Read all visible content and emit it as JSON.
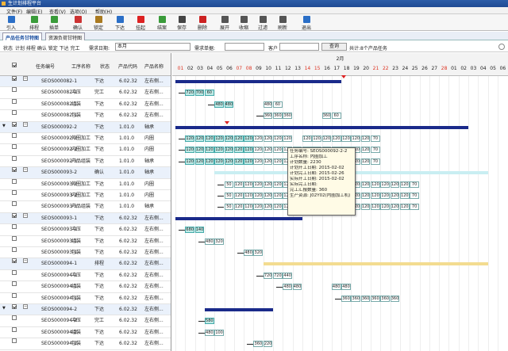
{
  "window": {
    "title": "生计划排程平台"
  },
  "menu": [
    "文件(F)",
    "编辑(E)",
    "查看(V)",
    "选项(O)",
    "帮助(H)"
  ],
  "toolbar": [
    {
      "label": "引入",
      "icon": "import-icon",
      "color": "#2b6fc7"
    },
    {
      "label": "排程",
      "icon": "schedule-icon",
      "color": "#3a9b3a"
    },
    {
      "label": "插单",
      "icon": "insert-order-icon",
      "color": "#3a9b3a"
    },
    {
      "label": "确认",
      "icon": "confirm-icon",
      "color": "#c33"
    },
    {
      "label": "锁定",
      "icon": "lock-icon",
      "color": "#aa7a20"
    },
    {
      "label": "下达",
      "icon": "release-icon",
      "color": "#2b6fc7"
    },
    {
      "label": "挂起",
      "icon": "suspend-icon",
      "color": "#d22"
    },
    {
      "label": "结案",
      "icon": "close-case-icon",
      "color": "#3a9b3a"
    },
    {
      "label": "保存",
      "icon": "save-icon",
      "color": "#444"
    },
    {
      "label": "删除",
      "icon": "delete-icon",
      "color": "#c22"
    },
    {
      "label": "展开",
      "icon": "expand-icon",
      "color": "#555"
    },
    {
      "label": "收缩",
      "icon": "collapse-icon",
      "color": "#555"
    },
    {
      "label": "过滤",
      "icon": "filter-icon",
      "color": "#555"
    },
    {
      "label": "刷新",
      "icon": "refresh-icon",
      "color": "#555"
    },
    {
      "label": "退出",
      "icon": "exit-icon",
      "color": "#2b6fc7"
    }
  ],
  "tabs": [
    "产品任务甘特图",
    "资源负荷甘特图"
  ],
  "filter": {
    "status_label": "状态",
    "status_value": "计划 排程 确认 锁定 下达 完工",
    "date_label": "需求日期:",
    "date_value": "本月",
    "order_label": "需求单据:",
    "order_value": "",
    "customer_label": "客户",
    "customer_value": "",
    "query_btn": "查询",
    "count_text": "共计:8个产品任务"
  },
  "grid": {
    "headers": [
      "任务编号",
      "工序名称",
      "状态",
      "产品代码",
      "产品名称"
    ],
    "rows": [
      {
        "level": 0,
        "checked": true,
        "exp": "−",
        "id": "SEOS000082-1",
        "proc": "",
        "status": "下达",
        "code": "6.02.32",
        "name": "左右侧..."
      },
      {
        "level": 1,
        "checked": false,
        "id": "SEOS000082-1",
        "proc": "冲压",
        "status": "完工",
        "code": "6.02.32",
        "name": "左右侧..."
      },
      {
        "level": 1,
        "checked": false,
        "id": "SEOS000082-1",
        "proc": "组装",
        "status": "下达",
        "code": "6.02.32",
        "name": "左右侧..."
      },
      {
        "level": 1,
        "checked": false,
        "id": "SEOS000082-1",
        "proc": "包装",
        "status": "下达",
        "code": "6.02.32",
        "name": "左右侧..."
      },
      {
        "level": 0,
        "checked": true,
        "exp": "−",
        "id": "SEOS000092-2",
        "proc": "",
        "status": "下达",
        "code": "1.01.0",
        "name": "轴承"
      },
      {
        "level": 1,
        "checked": false,
        "id": "SEOS000092-2",
        "proc": "外圈加工",
        "status": "下达",
        "code": "1.01.0",
        "name": "内圈"
      },
      {
        "level": 1,
        "checked": false,
        "id": "SEOS000092-2",
        "proc": "内圈加工",
        "status": "下达",
        "code": "1.01.0",
        "name": "内圈"
      },
      {
        "level": 1,
        "checked": false,
        "id": "SEOS000092-2",
        "proc": "产品组装",
        "status": "下达",
        "code": "1.01.0",
        "name": "轴承"
      },
      {
        "level": 0,
        "checked": true,
        "exp": "−",
        "id": "SEOS000093-2",
        "proc": "",
        "status": "确认",
        "code": "1.01.0",
        "name": "轴承"
      },
      {
        "level": 1,
        "checked": false,
        "id": "SEOS000093-2",
        "proc": "外圈加工",
        "status": "下达",
        "code": "1.01.0",
        "name": "内圈"
      },
      {
        "level": 1,
        "checked": false,
        "id": "SEOS000093-2",
        "proc": "内圈加工",
        "status": "下达",
        "code": "1.01.0",
        "name": "内圈"
      },
      {
        "level": 1,
        "checked": false,
        "id": "SEOS000093-2",
        "proc": "产品组装",
        "status": "下达",
        "code": "1.01.0",
        "name": "轴承"
      },
      {
        "level": 0,
        "checked": true,
        "exp": "−",
        "id": "SEOS000093-1",
        "proc": "",
        "status": "下达",
        "code": "6.02.32",
        "name": "左右侧..."
      },
      {
        "level": 1,
        "checked": false,
        "id": "SEOS000093-1",
        "proc": "冲压",
        "status": "下达",
        "code": "6.02.32",
        "name": "左右侧..."
      },
      {
        "level": 1,
        "checked": false,
        "id": "SEOS000093-1",
        "proc": "组装",
        "status": "下达",
        "code": "6.02.32",
        "name": "左右侧..."
      },
      {
        "level": 1,
        "checked": false,
        "id": "SEOS000093-1",
        "proc": "包装",
        "status": "下达",
        "code": "6.02.32",
        "name": "左右侧..."
      },
      {
        "level": 0,
        "checked": true,
        "exp": "−",
        "id": "SEOS000094-1",
        "proc": "",
        "status": "排程",
        "code": "6.02.32",
        "name": "左右侧..."
      },
      {
        "level": 1,
        "checked": false,
        "id": "SEOS000094-1",
        "proc": "冲压",
        "status": "下达",
        "code": "6.02.32",
        "name": "左右侧..."
      },
      {
        "level": 1,
        "checked": false,
        "id": "SEOS000094-1",
        "proc": "组装",
        "status": "下达",
        "code": "6.02.32",
        "name": "左右侧..."
      },
      {
        "level": 1,
        "checked": false,
        "id": "SEOS000094-1",
        "proc": "包装",
        "status": "下达",
        "code": "6.02.32",
        "name": "左右侧..."
      },
      {
        "level": 0,
        "checked": true,
        "exp": "−",
        "id": "SEOS000094-2",
        "proc": "",
        "status": "下达",
        "code": "6.02.32",
        "name": "左右侧..."
      },
      {
        "level": 1,
        "checked": false,
        "id": "SEOS000094-2",
        "proc": "冲压",
        "status": "完工",
        "code": "6.02.32",
        "name": "左右侧..."
      },
      {
        "level": 1,
        "checked": false,
        "id": "SEOS000094-2",
        "proc": "组装",
        "status": "下达",
        "code": "6.02.32",
        "name": "左右侧..."
      },
      {
        "level": 1,
        "checked": false,
        "id": "SEOS000094-2",
        "proc": "包装",
        "status": "下达",
        "code": "6.02.32",
        "name": "左右侧..."
      }
    ]
  },
  "gantt": {
    "month": "2月",
    "days": [
      "01",
      "02",
      "03",
      "04",
      "05",
      "06",
      "07",
      "08",
      "09",
      "10",
      "11",
      "12",
      "13",
      "14",
      "15",
      "16",
      "17",
      "18",
      "19",
      "20",
      "21",
      "22",
      "23",
      "24",
      "25",
      "26",
      "27",
      "28",
      "01",
      "02",
      "03",
      "04",
      "05",
      "06"
    ],
    "weekend_days": [
      "01",
      "07",
      "08",
      "14",
      "15",
      "21",
      "22",
      "28"
    ],
    "summary_bars": [
      {
        "row": 0,
        "start": 0,
        "end": 17,
        "color": "#1a2a8a"
      },
      {
        "row": 4,
        "start": 0,
        "end": 30,
        "color": "#1a2a8a"
      },
      {
        "row": 8,
        "start": 4,
        "end": 32,
        "color": "#c9eef2"
      },
      {
        "row": 12,
        "start": 0,
        "end": 13,
        "color": "#1a2a8a"
      },
      {
        "row": 16,
        "start": 9,
        "end": 32,
        "color": "#f3dc90"
      },
      {
        "row": 20,
        "start": 3,
        "end": 10,
        "color": "#1a2a8a"
      }
    ],
    "ops": [
      {
        "row": 1,
        "start": 1,
        "values": [
          "720",
          "700",
          "60"
        ],
        "done": true
      },
      {
        "row": 2,
        "start": 4,
        "values": [
          "480",
          "480",
          "",
          "",
          "",
          "480",
          "60"
        ],
        "done_count": 2
      },
      {
        "row": 3,
        "start": 9,
        "values": [
          "360",
          "360",
          "360",
          "",
          "",
          "",
          "360",
          "60"
        ]
      },
      {
        "row": 5,
        "start": 1,
        "values": [
          "120",
          "120",
          "120",
          "120",
          "120",
          "120",
          "120",
          "120",
          "120",
          "120",
          "120",
          "",
          "120",
          "120",
          "120",
          "120",
          "120",
          "120",
          "120",
          "70"
        ],
        "done_count": 7
      },
      {
        "row": 6,
        "start": 1,
        "values": [
          "120",
          "120",
          "120",
          "120",
          "120",
          "120",
          "120",
          "120",
          "120",
          "120",
          "120",
          "120",
          "120",
          "120",
          "120",
          "120",
          "120",
          "120",
          "120",
          "70"
        ],
        "done_count": 7
      },
      {
        "row": 7,
        "start": 1,
        "values": [
          "120",
          "120",
          "120",
          "120",
          "120",
          "120",
          "120",
          "120",
          "120",
          "120",
          "120",
          "120",
          "120",
          "120",
          "120",
          "120",
          "120",
          "120",
          "120",
          "70"
        ],
        "done_count": 7
      },
      {
        "row": 9,
        "start": 5,
        "values": [
          "50",
          "120",
          "120",
          "120",
          "120",
          "120",
          "120",
          "120",
          "120",
          "120",
          "120",
          "120",
          "120",
          "120",
          "120",
          "120",
          "120",
          "120",
          "120",
          "70"
        ]
      },
      {
        "row": 10,
        "start": 5,
        "values": [
          "50",
          "120",
          "120",
          "120",
          "120",
          "120",
          "120",
          "120",
          "120",
          "120",
          "120",
          "120",
          "120",
          "120",
          "120",
          "120",
          "120",
          "120",
          "120",
          "70"
        ]
      },
      {
        "row": 11,
        "start": 5,
        "values": [
          "50",
          "120",
          "120",
          "120",
          "120",
          "120",
          "120",
          "120",
          "120",
          "120",
          "120",
          "120",
          "120",
          "120",
          "120",
          "120",
          "120",
          "120",
          "120",
          "70"
        ]
      },
      {
        "row": 13,
        "start": 1,
        "values": [
          "680",
          "140"
        ],
        "done": true
      },
      {
        "row": 14,
        "start": 3,
        "values": [
          "480",
          "320"
        ]
      },
      {
        "row": 15,
        "start": 7,
        "values": [
          "480",
          "320"
        ]
      },
      {
        "row": 17,
        "start": 9,
        "values": [
          "720",
          "720",
          "440"
        ]
      },
      {
        "row": 18,
        "start": 11,
        "values": [
          "480",
          "480",
          "",
          "",
          "",
          "480",
          "480"
        ]
      },
      {
        "row": 19,
        "start": 17,
        "values": [
          "360",
          "360",
          "360",
          "360",
          "360",
          "360"
        ]
      },
      {
        "row": 21,
        "start": 3,
        "values": [
          "580"
        ],
        "done": true
      },
      {
        "row": 22,
        "start": 3,
        "values": [
          "480",
          "100"
        ]
      },
      {
        "row": 23,
        "start": 8,
        "values": [
          "360",
          "220"
        ]
      }
    ],
    "markers": [
      {
        "row": 0,
        "day": 17
      },
      {
        "row": 4,
        "day": 5
      },
      {
        "row": 12,
        "day": 12
      }
    ],
    "tooltip": [
      "任务编号: SEOS000092-2-2",
      "工序名称: 内圈加工",
      "计划数量: 2230",
      "计划开工日期: 2015-02-02",
      "计划完工日期: 2015-02-26",
      "实际开工日期: 2015-02-02",
      "实际完工日期:",
      "完工汇报数量: 360",
      "生产资源: J02Y02(内圈加工机)"
    ]
  }
}
